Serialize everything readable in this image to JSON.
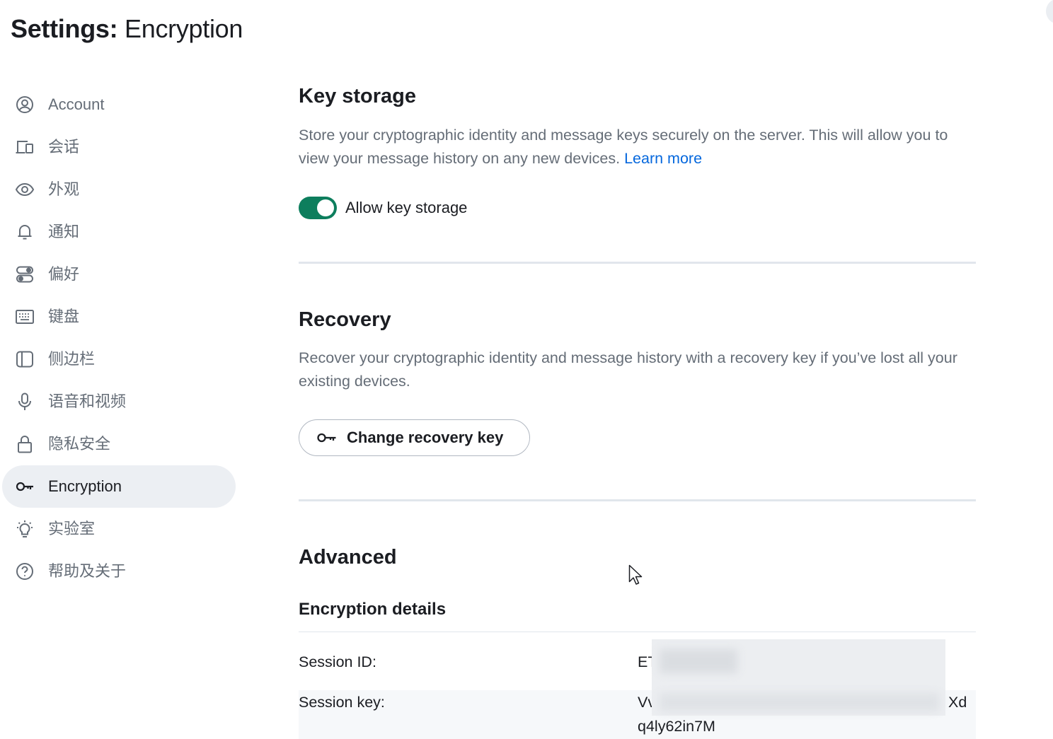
{
  "header": {
    "title_prefix": "Settings:",
    "title_section": "Encryption"
  },
  "sidebar": {
    "items": [
      {
        "label": "Account",
        "icon": "user-circle-icon",
        "active": false
      },
      {
        "label": "会话",
        "icon": "devices-icon",
        "active": false
      },
      {
        "label": "外观",
        "icon": "eye-icon",
        "active": false
      },
      {
        "label": "通知",
        "icon": "bell-icon",
        "active": false
      },
      {
        "label": "偏好",
        "icon": "preferences-icon",
        "active": false
      },
      {
        "label": "键盘",
        "icon": "keyboard-icon",
        "active": false
      },
      {
        "label": "侧边栏",
        "icon": "sidebar-icon",
        "active": false
      },
      {
        "label": "语音和视频",
        "icon": "microphone-icon",
        "active": false
      },
      {
        "label": "隐私安全",
        "icon": "lock-icon",
        "active": false
      },
      {
        "label": "Encryption",
        "icon": "key-icon",
        "active": true
      },
      {
        "label": "实验室",
        "icon": "lightbulb-icon",
        "active": false
      },
      {
        "label": "帮助及关于",
        "icon": "help-icon",
        "active": false
      }
    ]
  },
  "key_storage": {
    "title": "Key storage",
    "description": "Store your cryptographic identity and message keys securely on the server. This will allow you to view your message history on any new devices.",
    "learn_more": "Learn more",
    "toggle_label": "Allow key storage",
    "toggle_on": true
  },
  "recovery": {
    "title": "Recovery",
    "description": "Recover your cryptographic identity and message history with a recovery key if you’ve lost all your existing devices.",
    "button_label": "Change recovery key"
  },
  "advanced": {
    "title": "Advanced",
    "details_title": "Encryption details",
    "session_id_label": "Session ID:",
    "session_id_value": "ET",
    "session_key_label": "Session key:",
    "session_key_start": "Vv",
    "session_key_end": "Xd",
    "session_key_line2": "q4ly62in7M"
  },
  "colors": {
    "accent": "#0d7e5d",
    "link": "#0467dd",
    "text_primary": "#1b1d22",
    "text_secondary": "#656d77",
    "active_bg": "#eceff3"
  }
}
